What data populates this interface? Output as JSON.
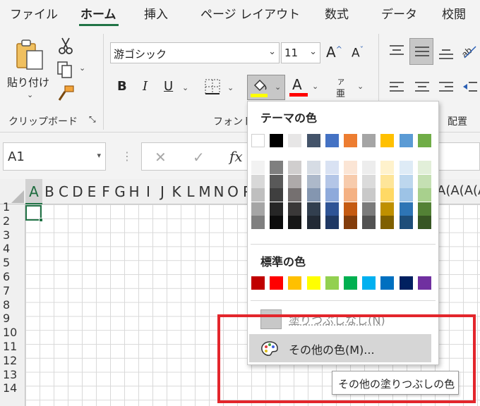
{
  "menu": {
    "tabs": [
      {
        "label": "ファイル"
      },
      {
        "label": "ホーム"
      },
      {
        "label": "挿入"
      },
      {
        "label": "ページ レイアウト"
      },
      {
        "label": "数式"
      },
      {
        "label": "データ"
      },
      {
        "label": "校閲"
      }
    ],
    "active_tab": "ホーム"
  },
  "ribbon": {
    "clipboard": {
      "paste_label": "貼り付け",
      "group_label": "クリップボード"
    },
    "font": {
      "font_name": "游ゴシック",
      "font_size": "11",
      "group_label": "フォント",
      "bold": "B",
      "italic": "I",
      "underline": "U",
      "font_color_letter": "A",
      "phonetic_top": "ア",
      "phonetic_bottom": "亜",
      "grow_font": "A",
      "shrink_font": "A",
      "fill_color": "#FFFF00",
      "font_color": "#FF0000"
    },
    "alignment": {
      "group_label": "配置"
    }
  },
  "formula_bar": {
    "name_box": "A1",
    "cancel_icon": "✕",
    "enter_icon": "✓",
    "fx": "fx"
  },
  "grid": {
    "columns": [
      "A",
      "B",
      "C",
      "D",
      "E",
      "F",
      "G",
      "H",
      "I",
      "J",
      "K",
      "L",
      "M",
      "N",
      "O",
      "P"
    ],
    "right_partial_columns": "(A(A(A(A(A",
    "rows": [
      "1",
      "2",
      "3",
      "4",
      "5",
      "6",
      "7",
      "8",
      "9",
      "10",
      "11",
      "12",
      "13",
      "14"
    ],
    "selected_cell": "A1"
  },
  "color_dropdown": {
    "theme_title": "テーマの色",
    "theme_colors": [
      "#FFFFFF",
      "#000000",
      "#E7E6E6",
      "#44546A",
      "#4472C4",
      "#ED7D31",
      "#A5A5A5",
      "#FFC000",
      "#5B9BD5",
      "#70AD47"
    ],
    "theme_shades": [
      [
        "#F2F2F2",
        "#7F7F7F",
        "#D0CECE",
        "#D6DCE4",
        "#D9E2F3",
        "#FBE5D5",
        "#EDEDED",
        "#FFF2CC",
        "#DEEBF6",
        "#E2EFD9"
      ],
      [
        "#D8D8D8",
        "#595959",
        "#AEAAAA",
        "#ADB9CA",
        "#B4C6E7",
        "#F7CBAC",
        "#DBDBDB",
        "#FEE599",
        "#BDD7EE",
        "#C5E0B3"
      ],
      [
        "#BFBFBF",
        "#3F3F3F",
        "#757070",
        "#8496B0",
        "#8EAADB",
        "#F4B183",
        "#C9C9C9",
        "#FFD965",
        "#9DC3E6",
        "#A8D08D"
      ],
      [
        "#A5A5A5",
        "#262626",
        "#3A3838",
        "#323F4F",
        "#2F5496",
        "#C55A11",
        "#7B7B7B",
        "#BF9000",
        "#2E75B5",
        "#538135"
      ],
      [
        "#7F7F7F",
        "#0C0C0C",
        "#161616",
        "#222A35",
        "#1F3864",
        "#833C0B",
        "#525252",
        "#7F6000",
        "#1E4E79",
        "#375623"
      ]
    ],
    "standard_title": "標準の色",
    "standard_colors": [
      "#C00000",
      "#FF0000",
      "#FFC000",
      "#FFFF00",
      "#92D050",
      "#00B050",
      "#00B0F0",
      "#0070C0",
      "#002060",
      "#7030A0"
    ],
    "no_fill_label": "塗りつぶしなし(N)",
    "more_colors_label": "その他の色(M)..."
  },
  "tooltip": "その他の塗りつぶしの色",
  "highlight_color": "#E3262C"
}
